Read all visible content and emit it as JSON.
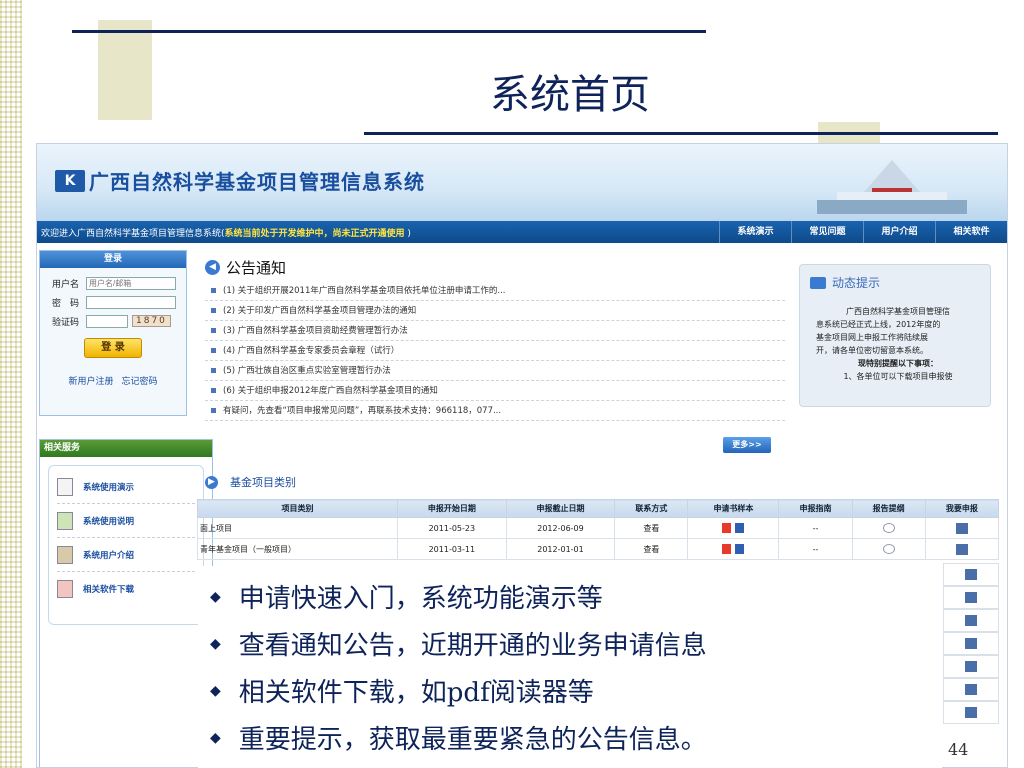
{
  "slide": {
    "title": "系统首页",
    "page_number": "44"
  },
  "app": {
    "system_name": "广西自然科学基金项目管理信息系统",
    "welcome": "欢迎进入广西自然科学基金项目管理信息系统(",
    "welcome_notice": "系统当前处于开发维护中，尚未正式开通使用",
    "welcome_end": " )",
    "nav": [
      "系统演示",
      "常见问题",
      "用户介绍",
      "相关软件"
    ],
    "login": {
      "title": "登录",
      "username_label": "用户名",
      "username_placeholder": "用户名/邮箱",
      "password_label": "密　码",
      "captcha_label": "验证码",
      "captcha_value": "1870",
      "button": "登 录",
      "register": "新用户注册",
      "forgot": "忘记密码"
    },
    "services": {
      "title": "相关服务",
      "items": [
        "系统使用演示",
        "系统使用说明",
        "系统用户介绍",
        "相关软件下载"
      ]
    },
    "notice": {
      "title": "公告通知",
      "items": [
        "(1) 关于组织开展2011年广西自然科学基金项目依托单位注册申请工作的...",
        "(2) 关于印发广西自然科学基金项目管理办法的通知",
        "(3) 广西自然科学基金项目资助经费管理暂行办法",
        "(4) 广西自然科学基金专家委员会章程（试行）",
        "(5) 广西壮族自治区重点实验室管理暂行办法",
        "(6) 关于组织申报2012年度广西自然科学基金项目的通知",
        "有疑问，先查看“项目申报常见问题”，再联系技术支持：966118，077..."
      ],
      "more": "更多>>"
    },
    "dynamic": {
      "title": "动态提示",
      "line1": "广西自然科学基金项目管理信",
      "line2": "息系统已经正式上线，2012年度的",
      "line3": "基金项目网上申报工作将陆续展",
      "line4": "开，请各单位密切留意本系统。",
      "emph": "现特别提醒以下事项：",
      "line5": "1、各单位可以下载项目申报使"
    },
    "categories": {
      "title": "基金项目类别",
      "headers": [
        "项目类别",
        "申报开始日期",
        "申报截止日期",
        "联系方式",
        "申请书样本",
        "申报指南",
        "报告提纲",
        "我要申报"
      ],
      "rows": [
        {
          "type": "面上项目",
          "start": "2011-05-23",
          "end": "2012-06-09",
          "contact": "查看",
          "guide": "--"
        },
        {
          "type": "青年基金项目（一般项目）",
          "start": "2011-03-11",
          "end": "2012-01-01",
          "contact": "查看",
          "guide": "--"
        }
      ]
    }
  },
  "bullets": [
    "申请快速入门，系统功能演示等",
    "查看通知公告，近期开通的业务申请信息",
    "相关软件下载，如pdf阅读器等",
    "重要提示，获取最重要紧急的公告信息。"
  ]
}
